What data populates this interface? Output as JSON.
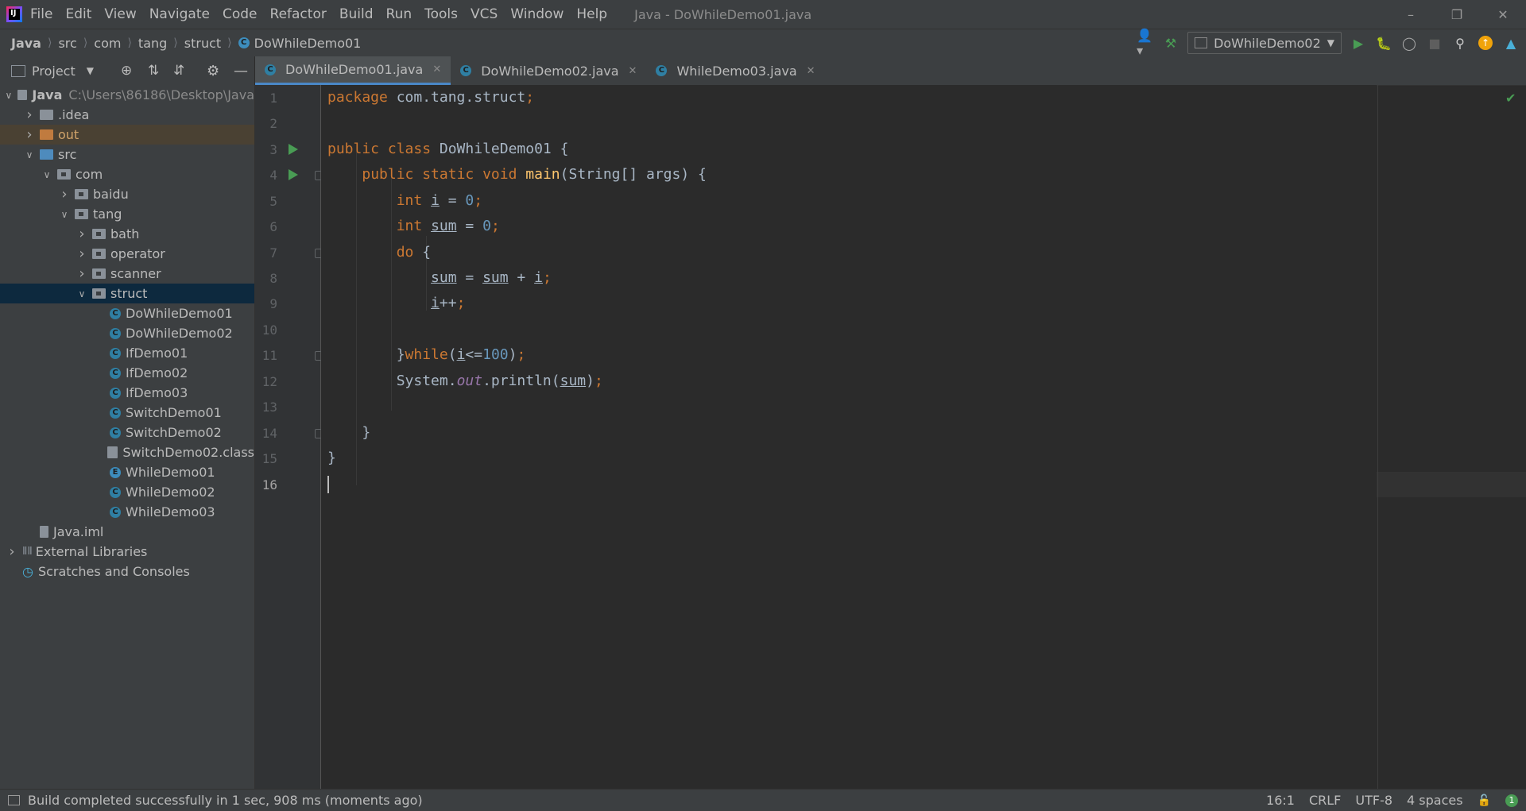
{
  "window": {
    "title": "Java - DoWhileDemo01.java",
    "menu": [
      "File",
      "Edit",
      "View",
      "Navigate",
      "Code",
      "Refactor",
      "Build",
      "Run",
      "Tools",
      "VCS",
      "Window",
      "Help"
    ]
  },
  "breadcrumb": [
    "Java",
    "src",
    "com",
    "tang",
    "struct",
    "DoWhileDemo01"
  ],
  "run_config": "DoWhileDemo02",
  "project_panel": {
    "title": "Project",
    "root_path": "C:\\Users\\86186\\Desktop\\Java",
    "tree": [
      {
        "label": "Java",
        "depth": 0,
        "expanded": true,
        "kind": "module"
      },
      {
        "label": ".idea",
        "depth": 1,
        "expanded": false,
        "kind": "folder"
      },
      {
        "label": "out",
        "depth": 1,
        "expanded": false,
        "kind": "folder-excluded"
      },
      {
        "label": "src",
        "depth": 1,
        "expanded": true,
        "kind": "folder-src"
      },
      {
        "label": "com",
        "depth": 2,
        "expanded": true,
        "kind": "package"
      },
      {
        "label": "baidu",
        "depth": 3,
        "expanded": false,
        "kind": "package"
      },
      {
        "label": "tang",
        "depth": 3,
        "expanded": true,
        "kind": "package"
      },
      {
        "label": "bath",
        "depth": 4,
        "expanded": false,
        "kind": "package"
      },
      {
        "label": "operator",
        "depth": 4,
        "expanded": false,
        "kind": "package"
      },
      {
        "label": "scanner",
        "depth": 4,
        "expanded": false,
        "kind": "package"
      },
      {
        "label": "struct",
        "depth": 4,
        "expanded": true,
        "kind": "package",
        "selected": true
      },
      {
        "label": "DoWhileDemo01",
        "depth": 5,
        "kind": "class"
      },
      {
        "label": "DoWhileDemo02",
        "depth": 5,
        "kind": "class"
      },
      {
        "label": "IfDemo01",
        "depth": 5,
        "kind": "class"
      },
      {
        "label": "IfDemo02",
        "depth": 5,
        "kind": "class"
      },
      {
        "label": "IfDemo03",
        "depth": 5,
        "kind": "class"
      },
      {
        "label": "SwitchDemo01",
        "depth": 5,
        "kind": "class"
      },
      {
        "label": "SwitchDemo02",
        "depth": 5,
        "kind": "class"
      },
      {
        "label": "SwitchDemo02.class",
        "depth": 5,
        "kind": "classfile"
      },
      {
        "label": "WhileDemo01",
        "depth": 5,
        "kind": "class-error"
      },
      {
        "label": "WhileDemo02",
        "depth": 5,
        "kind": "class"
      },
      {
        "label": "WhileDemo03",
        "depth": 5,
        "kind": "class"
      },
      {
        "label": "Java.iml",
        "depth": 1,
        "kind": "iml"
      },
      {
        "label": "External Libraries",
        "depth": 0,
        "expanded": false,
        "kind": "libraries"
      },
      {
        "label": "Scratches and Consoles",
        "depth": 0,
        "kind": "scratches"
      }
    ]
  },
  "tabs": [
    {
      "label": "DoWhileDemo01.java",
      "active": true
    },
    {
      "label": "DoWhileDemo02.java",
      "active": false
    },
    {
      "label": "WhileDemo03.java",
      "active": false
    }
  ],
  "editor": {
    "line_numbers": [
      "1",
      "2",
      "3",
      "4",
      "5",
      "6",
      "7",
      "8",
      "9",
      "10",
      "11",
      "12",
      "13",
      "14",
      "15",
      "16"
    ],
    "current_line": "16"
  },
  "status": {
    "message": "Build completed successfully in 1 sec, 908 ms (moments ago)",
    "position": "16:1",
    "line_ending": "CRLF",
    "encoding": "UTF-8",
    "indent": "4 spaces",
    "notifications": "1"
  },
  "colors": {
    "keyword": "#cc7832",
    "function": "#ffc66d",
    "number": "#6897bb",
    "field": "#9876aa",
    "accent": "#4a88c7",
    "run_green": "#499c54"
  }
}
